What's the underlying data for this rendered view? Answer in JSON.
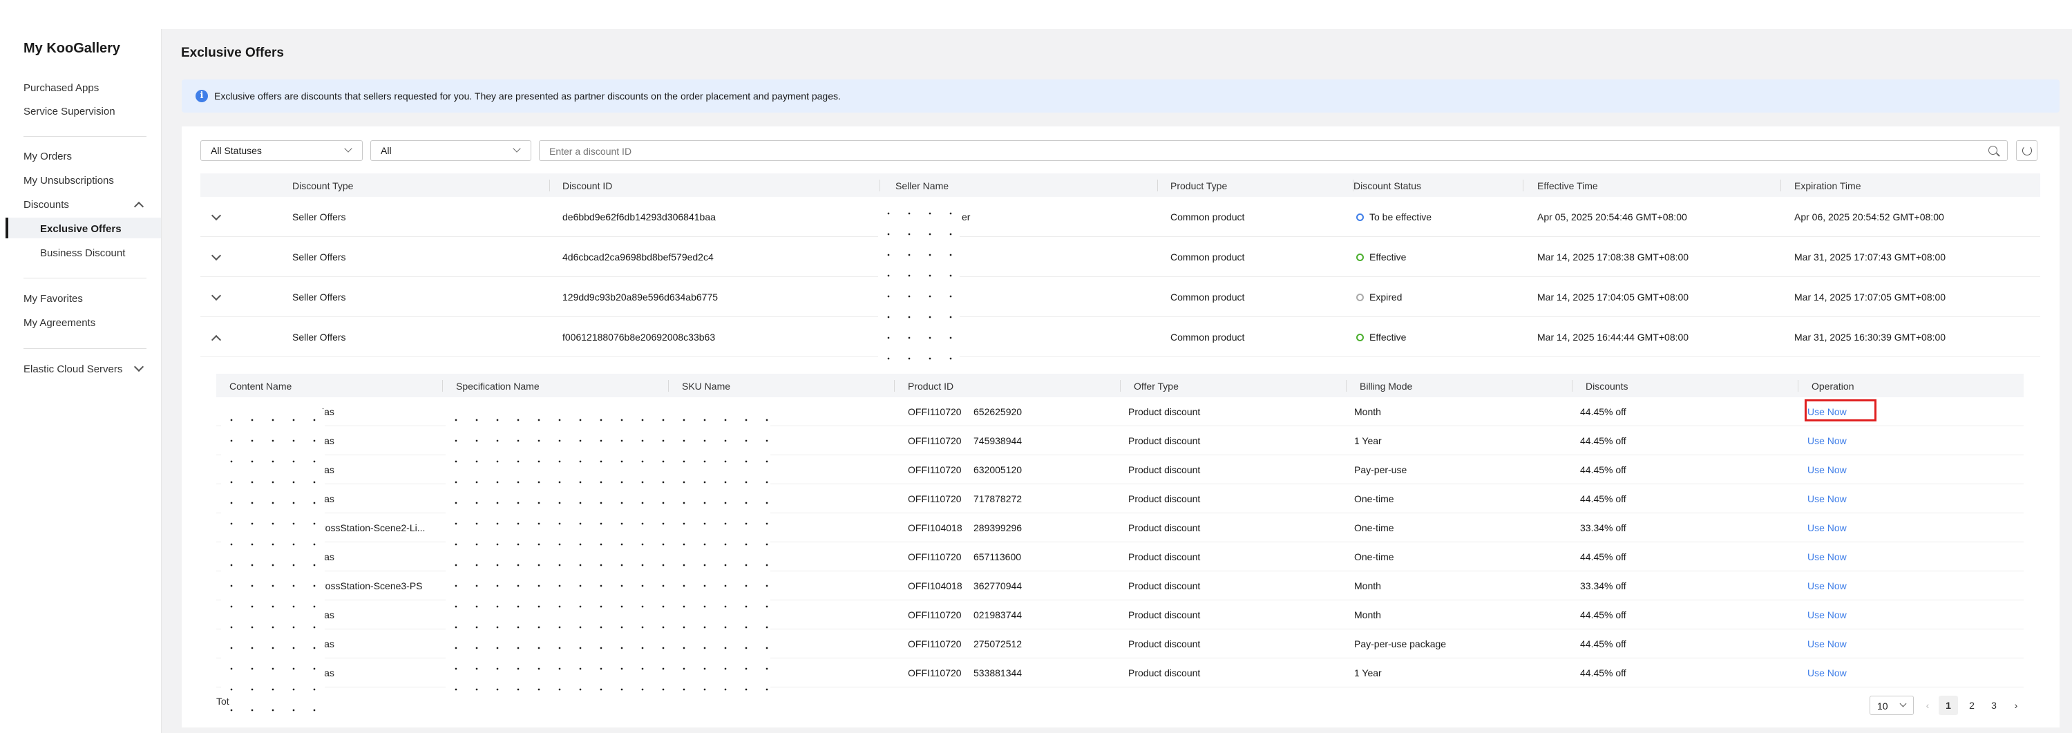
{
  "sidebar": {
    "title": "My KooGallery",
    "items": [
      {
        "label": "Purchased Apps"
      },
      {
        "label": "Service Supervision"
      },
      {
        "label": "My Orders"
      },
      {
        "label": "My Unsubscriptions"
      },
      {
        "label": "Discounts"
      },
      {
        "label": "Exclusive Offers"
      },
      {
        "label": "Business Discount"
      },
      {
        "label": "My Favorites"
      },
      {
        "label": "My Agreements"
      },
      {
        "label": "Elastic Cloud Servers"
      }
    ]
  },
  "main": {
    "title": "Exclusive Offers",
    "info": "Exclusive offers are discounts that sellers requested for you. They are presented as partner discounts on the order placement and payment pages.",
    "filters": {
      "status": "All Statuses",
      "type": "All",
      "search_placeholder": "Enter a discount ID"
    },
    "columns": [
      "Discount Type",
      "Discount ID",
      "Seller Name",
      "Product Type",
      "Discount Status",
      "Effective Time",
      "Expiration Time"
    ],
    "rows": [
      {
        "type": "Seller Offers",
        "id": "de6bbd9e62f6db14293d306841baa",
        "seller": "er",
        "product_type": "Common product",
        "status": "To be effective",
        "status_color": "#3f7ee8",
        "effective": "Apr 05, 2025 20:54:46 GMT+08:00",
        "expiration": "Apr 06, 2025 20:54:52 GMT+08:00"
      },
      {
        "type": "Seller Offers",
        "id": "4d6cbcad2ca9698bd8bef579ed2c4",
        "seller": "",
        "product_type": "Common product",
        "status": "Effective",
        "status_color": "#4caf2f",
        "effective": "Mar 14, 2025 17:08:38 GMT+08:00",
        "expiration": "Mar 31, 2025 17:07:43 GMT+08:00"
      },
      {
        "type": "Seller Offers",
        "id": "129dd9c93b20a89e596d634ab6775",
        "seller": "",
        "product_type": "Common product",
        "status": "Expired",
        "status_color": "#aaaaaa",
        "effective": "Mar 14, 2025 17:04:05 GMT+08:00",
        "expiration": "Mar 14, 2025 17:07:05 GMT+08:00"
      },
      {
        "type": "Seller Offers",
        "id": "f00612188076b8e20692008c33b63",
        "seller": "",
        "product_type": "Common product",
        "status": "Effective",
        "status_color": "#4caf2f",
        "effective": "Mar 14, 2025 16:44:44 GMT+08:00",
        "expiration": "Mar 31, 2025 16:30:39 GMT+08:00"
      }
    ],
    "sub_columns": [
      "Content Name",
      "Specification Name",
      "SKU Name",
      "Product ID",
      "Offer Type",
      "Billing Mode",
      "Discounts",
      "Operation"
    ],
    "sub_rows": [
      {
        "content": "s",
        "content2": "ias",
        "product_id": "OFFI110720",
        "product_id2": "652625920",
        "offer": "Product discount",
        "billing": "Month",
        "discount": "44.45% off",
        "op": "Use Now"
      },
      {
        "content": "s",
        "content2": "ias",
        "product_id": "OFFI110720",
        "product_id2": "745938944",
        "offer": "Product discount",
        "billing": "1 Year",
        "discount": "44.45% off",
        "op": "Use Now"
      },
      {
        "content": "s",
        "content2": "ias",
        "product_id": "OFFI110720",
        "product_id2": "632005120",
        "offer": "Product discount",
        "billing": "Pay-per-use",
        "discount": "44.45% off",
        "op": "Use Now"
      },
      {
        "content": "s",
        "content2": "ias",
        "product_id": "OFFI110720",
        "product_id2": "717878272",
        "offer": "Product discount",
        "billing": "One-time",
        "discount": "44.45% off",
        "op": "Use Now"
      },
      {
        "content": "g",
        "content2": "rossStation-Scene2-Li...",
        "product_id": "OFFI104018",
        "product_id2": "289399296",
        "offer": "Product discount",
        "billing": "One-time",
        "discount": "33.34% off",
        "op": "Use Now"
      },
      {
        "content": "s",
        "content2": "ias",
        "product_id": "OFFI110720",
        "product_id2": "657113600",
        "offer": "Product discount",
        "billing": "One-time",
        "discount": "44.45% off",
        "op": "Use Now"
      },
      {
        "content": "g",
        "content2": "rossStation-Scene3-PS",
        "product_id": "OFFI104018",
        "product_id2": "362770944",
        "offer": "Product discount",
        "billing": "Month",
        "discount": "33.34% off",
        "op": "Use Now"
      },
      {
        "content": "s",
        "content2": "ias",
        "product_id": "OFFI110720",
        "product_id2": "021983744",
        "offer": "Product discount",
        "billing": "Month",
        "discount": "44.45% off",
        "op": "Use Now"
      },
      {
        "content": "s",
        "content2": "ias",
        "product_id": "OFFI110720",
        "product_id2": "275072512",
        "offer": "Product discount",
        "billing": "Pay-per-use package",
        "discount": "44.45% off",
        "op": "Use Now"
      },
      {
        "content": "s",
        "content2": "ias",
        "product_id": "OFFI110720",
        "product_id2": "533881344",
        "offer": "Product discount",
        "billing": "1 Year",
        "discount": "44.45% off",
        "op": "Use Now"
      }
    ],
    "pager": {
      "total": "Tot",
      "size": "10",
      "pages": [
        "1",
        "2",
        "3"
      ],
      "prev": "‹",
      "next": "›"
    }
  }
}
